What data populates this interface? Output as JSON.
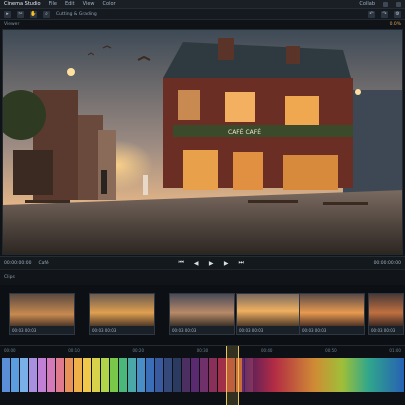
{
  "menubar": {
    "app": "Cinema Studio",
    "items": [
      "File",
      "Edit",
      "View",
      "Color"
    ],
    "right": [
      "Collab"
    ]
  },
  "toolbar": {
    "status": "Cutting & Grading"
  },
  "viewer_header": {
    "left": "Viewer",
    "zoom": "0.0%"
  },
  "viewer_image": {
    "sign_text": "CAFÉ CAFÉ"
  },
  "transport": {
    "timecode_left": "00:00:00:00",
    "clip_name": "Café",
    "timecode_right": "00:00:00:00"
  },
  "strip": {
    "label": "Clips"
  },
  "clips": [
    {
      "label": "00:03 00:03"
    },
    {
      "label": "00:03 00:03"
    },
    {
      "label": "00:03 00:03"
    },
    {
      "label": "00:03 00:03"
    },
    {
      "label": "00:03 00:03"
    },
    {
      "label": "00:03 00:03"
    }
  ],
  "ruler": [
    "00:00",
    "00:10",
    "00:20",
    "00:30",
    "00:40",
    "00:50",
    "01:00"
  ],
  "swatch_colors": [
    "#5a8fd8",
    "#5a9ee0",
    "#7ab0e8",
    "#a98fe0",
    "#c27fd6",
    "#d47ab8",
    "#e07a8f",
    "#e8925a",
    "#efb04a",
    "#f0c84a",
    "#d8d24a",
    "#b0d44a",
    "#7ac84a",
    "#4ab87a",
    "#4aa8a8",
    "#4a8ec8",
    "#3a6eb8",
    "#3a5aa0",
    "#34487a",
    "#2a3a60",
    "#4a2f60",
    "#5a2a70",
    "#70306a",
    "#8a2f5a",
    "#a0304a",
    "#b8483a",
    "#c86a3a",
    "#d88a3a"
  ]
}
